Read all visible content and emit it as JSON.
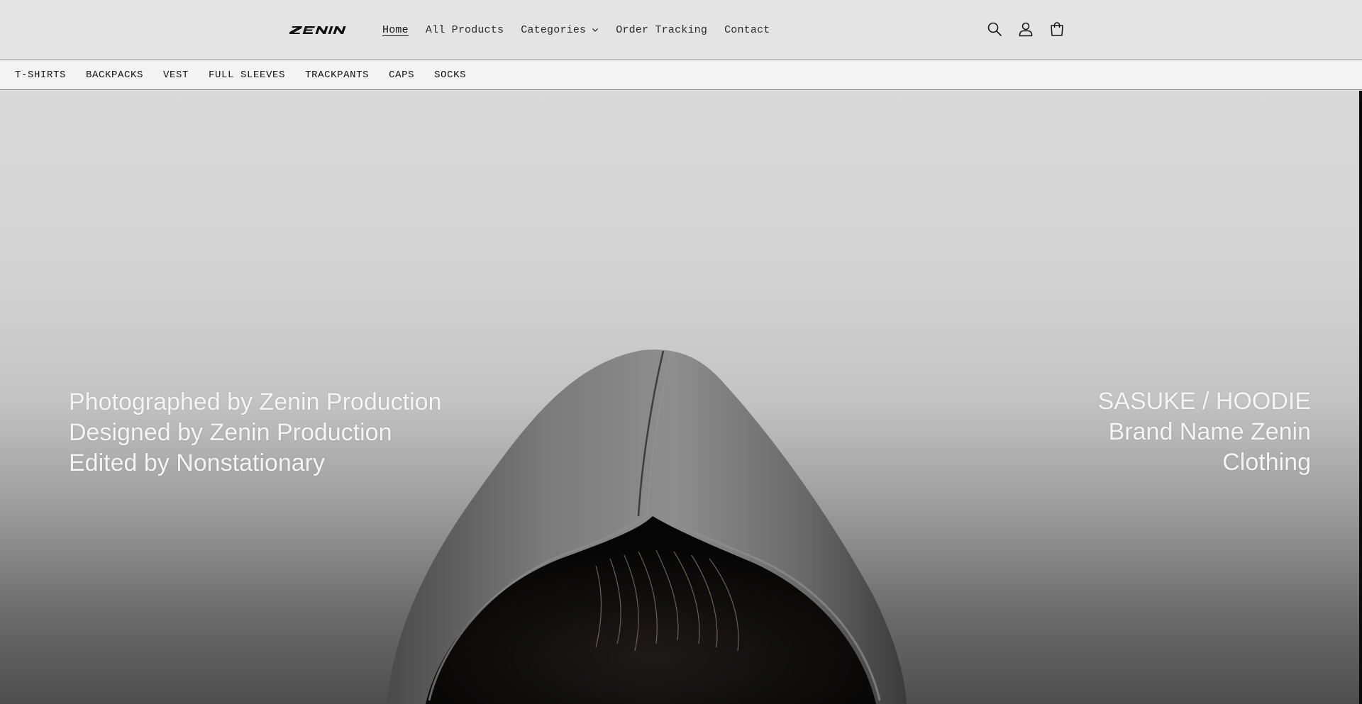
{
  "header": {
    "brand": "ZENIN",
    "nav": [
      {
        "label": "Home",
        "active": true
      },
      {
        "label": "All Products"
      },
      {
        "label": "Categories",
        "has_dropdown": true
      },
      {
        "label": "Order Tracking"
      },
      {
        "label": "Contact"
      }
    ],
    "icons": [
      "search-icon",
      "account-icon",
      "cart-icon"
    ]
  },
  "categories": [
    "T-SHIRTS",
    "BACKPACKS",
    "VEST",
    "FULL SLEEVES",
    "TRACKPANTS",
    "CAPS",
    "SOCKS"
  ],
  "hero": {
    "left_lines": [
      "Photographed by Zenin Production",
      "Designed by Zenin Production",
      "Edited by Nonstationary"
    ],
    "right_lines": [
      "SASUKE / HOODIE",
      "Brand Name Zenin",
      "Clothing"
    ]
  },
  "colors": {
    "header_bg": "#e4e4e4",
    "catbar_bg": "#f3f3f3",
    "text": "#121212",
    "hero_text": "#f4f4f4"
  }
}
